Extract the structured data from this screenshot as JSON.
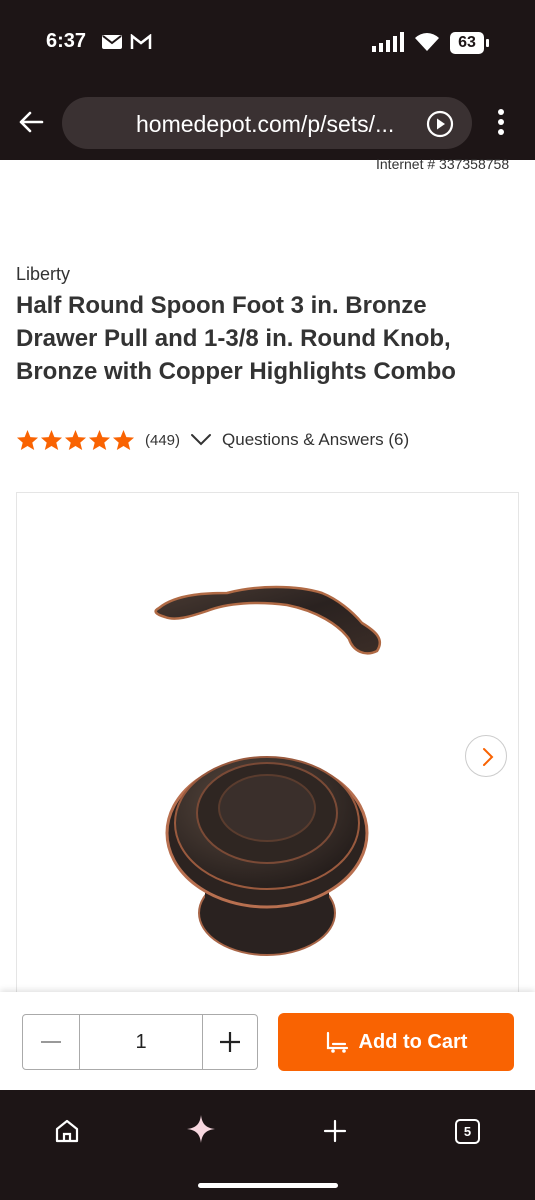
{
  "status_bar": {
    "time": "6:37",
    "battery": "63",
    "icons": [
      "mail-icon",
      "gmail-icon",
      "signal-icon",
      "wifi-icon",
      "battery-icon"
    ]
  },
  "browser": {
    "url": "homedepot.com/p/sets/...",
    "icons": [
      "back-arrow-icon",
      "play-icon",
      "kebab-menu-icon"
    ]
  },
  "product": {
    "internet_number": "Internet # 337358758",
    "brand": "Liberty",
    "title": "Half Round Spoon Foot 3 in. Bronze Drawer Pull and 1-3/8 in. Round Knob, Bronze with Copper Highlights Combo",
    "rating": 5,
    "review_count": "(449)",
    "qa_link": "Questions & Answers (6)"
  },
  "cart": {
    "quantity": "1",
    "add_to_cart_label": "Add to Cart"
  },
  "bottom_nav": {
    "tab_count": "5",
    "icons": [
      "home-icon",
      "sparkle-icon",
      "plus-icon",
      "tabs-icon"
    ]
  },
  "colors": {
    "accent": "#f96302",
    "chrome_dark": "#1d1516",
    "text": "#333333"
  }
}
